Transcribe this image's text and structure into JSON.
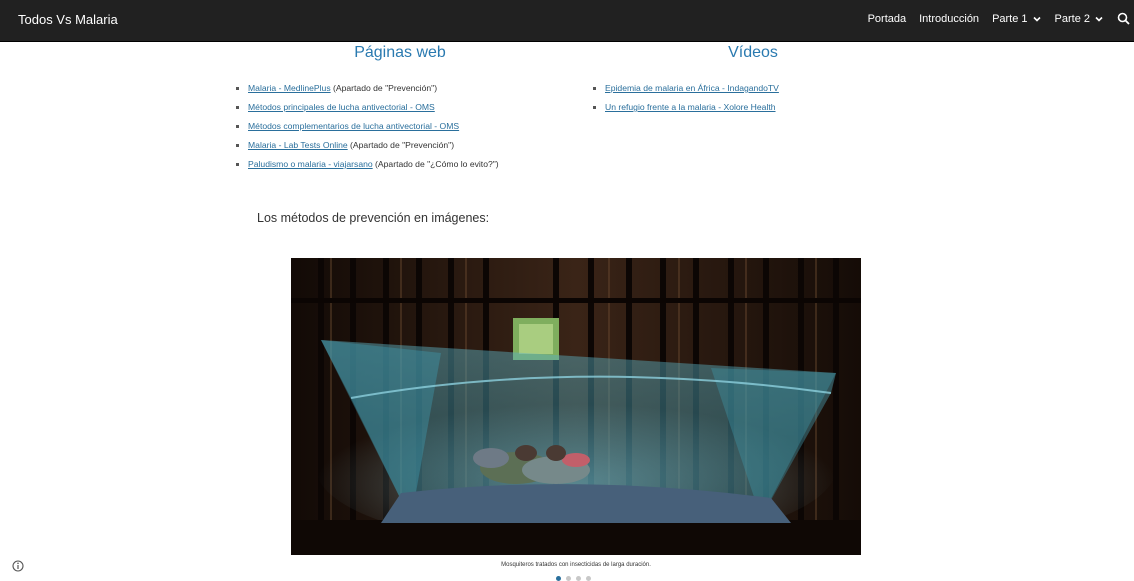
{
  "header": {
    "site_title": "Todos Vs Malaria",
    "nav": [
      {
        "label": "Portada"
      },
      {
        "label": "Introducción"
      },
      {
        "label": "Parte 1"
      },
      {
        "label": "Parte 2"
      }
    ]
  },
  "left_column": {
    "heading": "Páginas web",
    "items": [
      {
        "link": "Malaria - MedlinePlus",
        "note": " (Apartado de \"Prevención\")"
      },
      {
        "link": "Métodos principales de lucha antivectorial - OMS",
        "note": ""
      },
      {
        "link": "Métodos complementarios de lucha antivectorial - OMS",
        "note": ""
      },
      {
        "link": "Malaria - Lab Tests Online",
        "note": " (Apartado de \"Prevención\")"
      },
      {
        "link": "Paludismo o malaria - viajarsano",
        "note": " (Apartado de \"¿Cómo lo evito?\")"
      }
    ]
  },
  "right_column": {
    "heading": "Vídeos",
    "items": [
      {
        "link": "Epidemia de malaria en África - IndagandoTV"
      },
      {
        "link": "Un refugio frente a la malaria - Xolore Health"
      }
    ]
  },
  "gallery": {
    "heading": "Los métodos de prevención en imágenes:",
    "caption": "Mosquiteros tratados con insecticidas de larga duración.",
    "slide_count": 4,
    "active_slide": 1
  },
  "icons": {
    "search": "search-icon",
    "chevron": "chevron-down-icon",
    "info": "info-icon"
  },
  "colors": {
    "topbar": "#212121",
    "link": "#2a6f9c",
    "heading_accent": "#2a7ab0"
  }
}
